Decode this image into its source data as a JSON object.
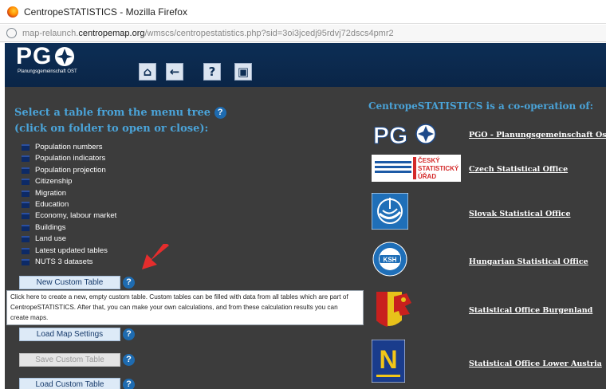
{
  "browser": {
    "window_title": "CentropeSTATISTICS - Mozilla Firefox",
    "url_prefix": "map-relaunch.",
    "url_domain": "centropemap.org",
    "url_path": "/wmscs/centropestatistics.php?sid=3oi3jcedj95rdvj72dscs4pmr2"
  },
  "header": {
    "logo_text": "PG",
    "logo_subtitle": "Planungsgemeinschaft OST",
    "buttons": [
      {
        "icon": "home-icon",
        "glyph": "⌂"
      },
      {
        "icon": "back-arrow-icon",
        "glyph": "←"
      },
      {
        "icon": "help-icon",
        "glyph": "?"
      },
      {
        "icon": "close-window-icon",
        "glyph": "▣"
      }
    ]
  },
  "left": {
    "intro_line1": "Select a table from the menu tree",
    "intro_line2": "(click on folder to open or close):",
    "help_glyph": "?",
    "tree": [
      "Population numbers",
      "Population indicators",
      "Population projection",
      "Citizenship",
      "Migration",
      "Education",
      "Economy, labour market",
      "Buildings",
      "Land use",
      "Latest updated tables",
      "NUTS 3 datasets"
    ],
    "buttons": {
      "new_custom_table": "New Custom Table",
      "load_map_settings": "Load Map Settings",
      "save_custom_table": "Save Custom Table",
      "load_custom_table": "Load Custom Table"
    },
    "tooltip_line1": "Click here to create a new, empty custom table. Custom tables can be filled with data from all tables which are part of",
    "tooltip_line2": "CentropeSTATISTICS. After that, you can make your own calculations, and from these calculation results you can",
    "tooltip_line3": "create maps."
  },
  "right": {
    "title": "CentropeSTATISTICS is a co-operation of:",
    "orgs": [
      {
        "name": "PGO - Planungsgemeinschaft Ost",
        "logo": "pgo-logo"
      },
      {
        "name": "Czech Statistical Office",
        "logo": "czso-logo",
        "logo_text": [
          "ČESKÝ",
          "STATISTICKÝ",
          "ÚŘAD"
        ]
      },
      {
        "name": "Slovak Statistical Office",
        "logo": "slovak-stat-logo"
      },
      {
        "name": "Hungarian Statistical Office",
        "logo": "ksh-logo",
        "logo_text": "KSH"
      },
      {
        "name": "Statistical Office Burgenland",
        "logo": "burgenland-logo"
      },
      {
        "name": "Statistical Office Lower Austria",
        "logo": "lower-austria-logo",
        "logo_text": "N"
      }
    ]
  },
  "colors": {
    "background": "#3c3c3c",
    "header": "#0d2e55",
    "accent_text": "#4aa3d8",
    "help_icon": "#1e6bb0",
    "arrow": "#e52d2d"
  }
}
